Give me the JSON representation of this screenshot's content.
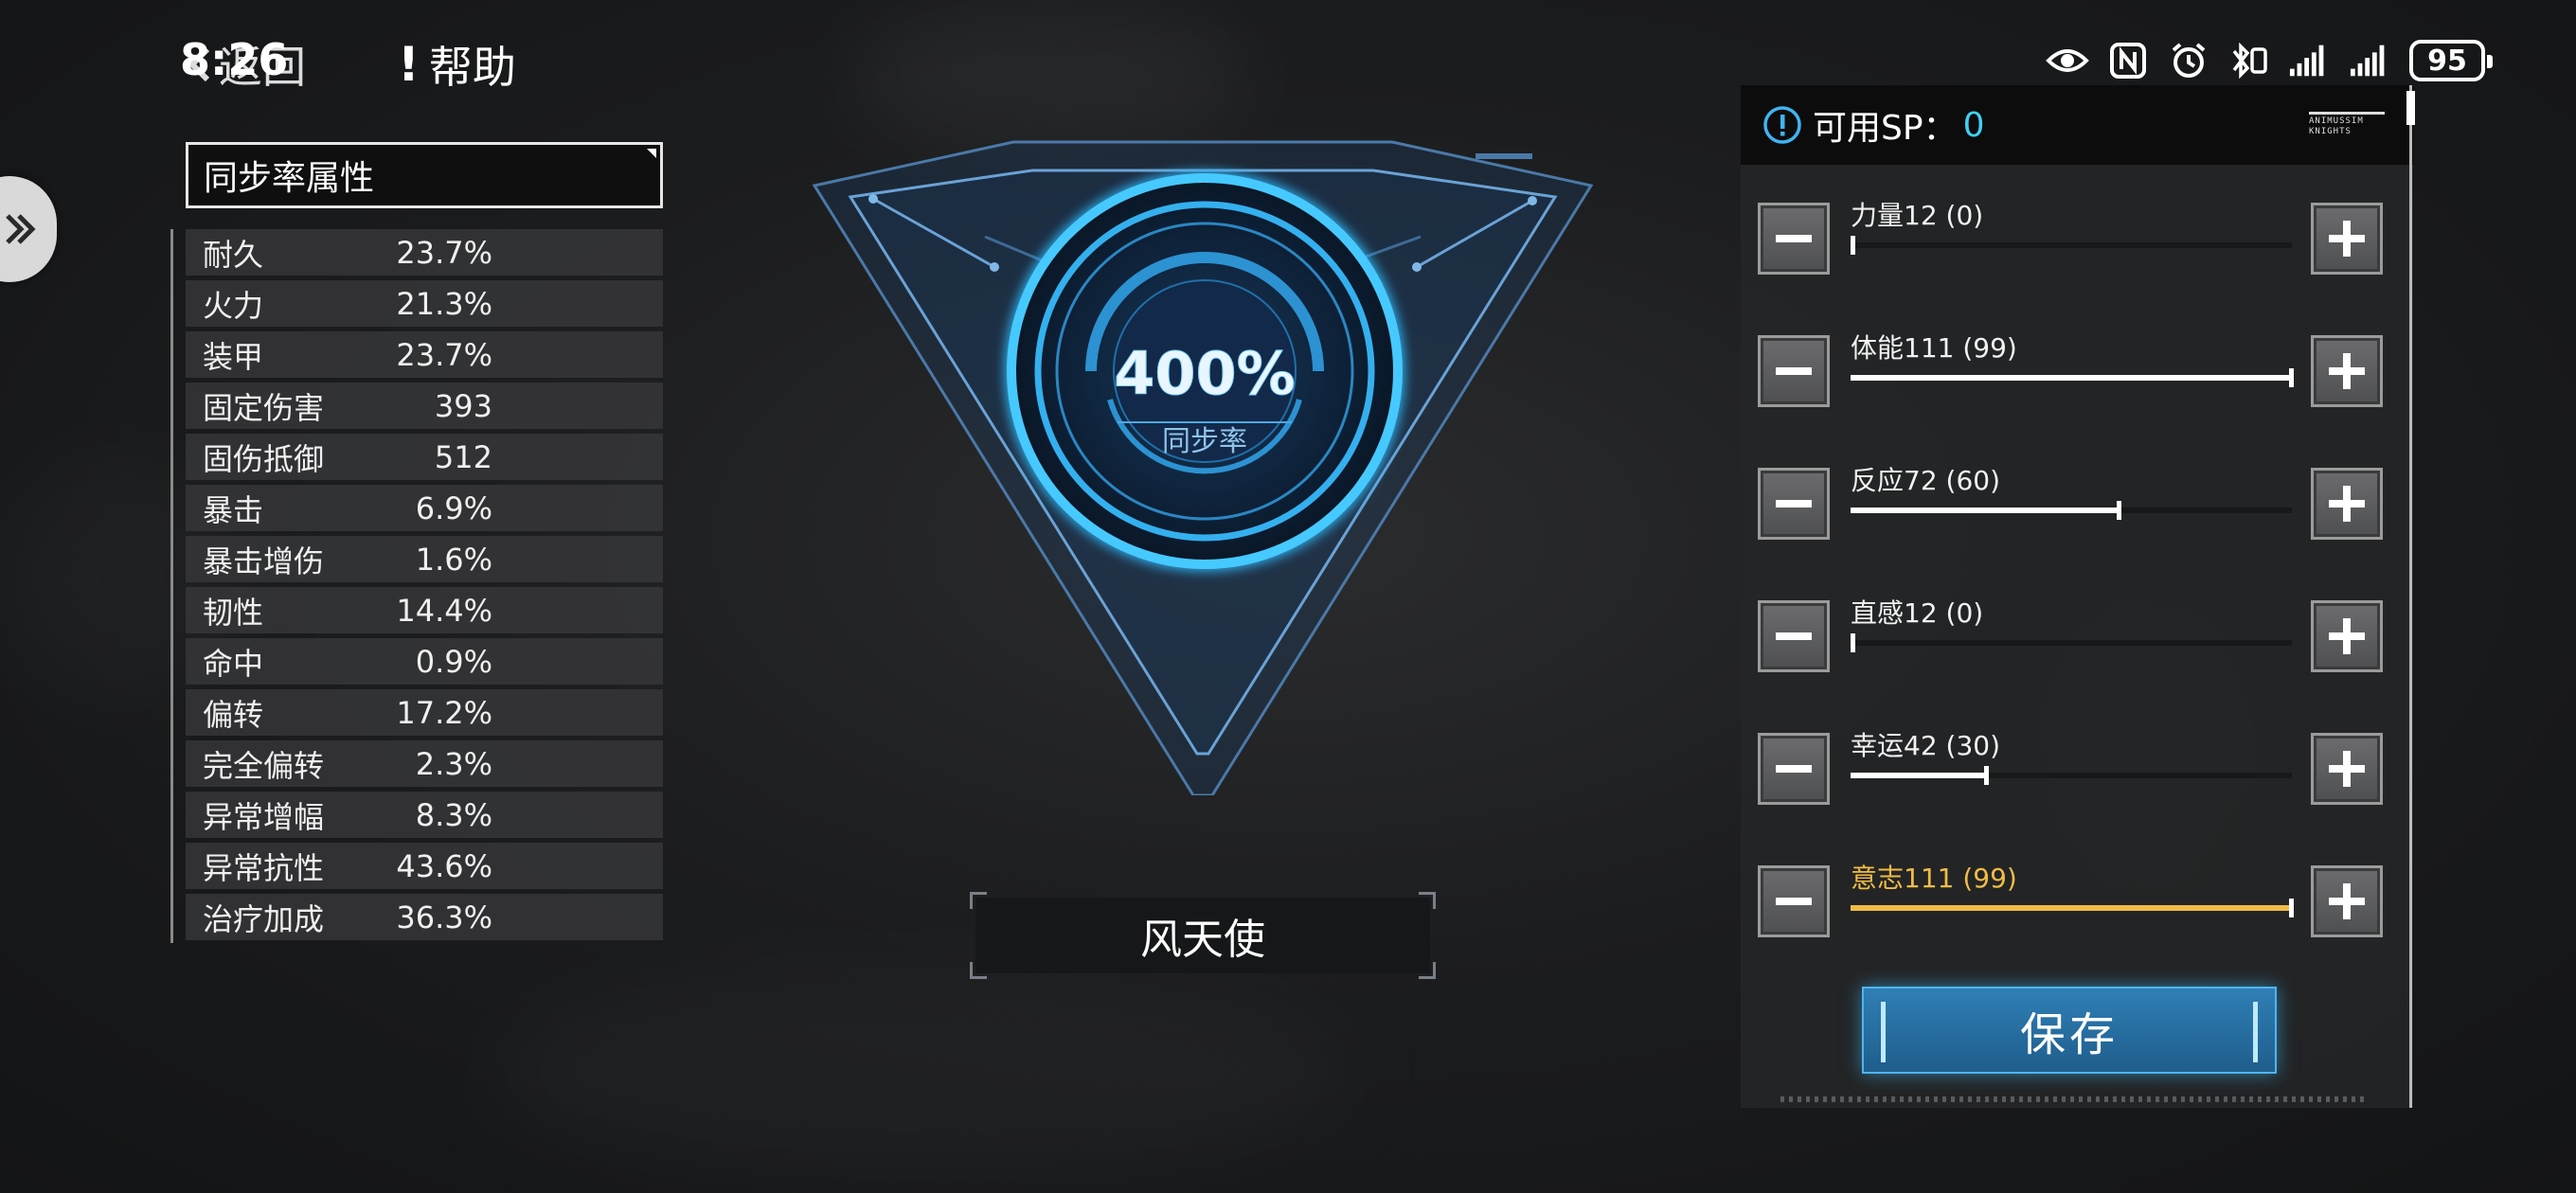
{
  "status_bar": {
    "time": "8:26",
    "battery": "95",
    "icons": [
      "eye-icon",
      "nfc-icon",
      "alarm-icon",
      "bluetooth-icon",
      "vibrate-icon",
      "signal-icon",
      "signal-icon"
    ]
  },
  "nav": {
    "back_label": "返回",
    "help_label": "帮助",
    "help_mark": "!"
  },
  "attributes": {
    "title": "同步率属性",
    "items": [
      {
        "name": "耐久",
        "value": "23.7%"
      },
      {
        "name": "火力",
        "value": "21.3%"
      },
      {
        "name": "装甲",
        "value": "23.7%"
      },
      {
        "name": "固定伤害",
        "value": "393"
      },
      {
        "name": "固伤抵御",
        "value": "512"
      },
      {
        "name": "暴击",
        "value": "6.9%"
      },
      {
        "name": "暴击增伤",
        "value": "1.6%"
      },
      {
        "name": "韧性",
        "value": "14.4%"
      },
      {
        "name": "命中",
        "value": "0.9%"
      },
      {
        "name": "偏转",
        "value": "17.2%"
      },
      {
        "name": "完全偏转",
        "value": "2.3%"
      },
      {
        "name": "异常增幅",
        "value": "8.3%"
      },
      {
        "name": "异常抗性",
        "value": "43.6%"
      },
      {
        "name": "治疗加成",
        "value": "36.3%"
      }
    ]
  },
  "sync": {
    "percent": "400%",
    "label": "同步率"
  },
  "character": {
    "name": "风天使"
  },
  "sp_panel": {
    "label": "可用SP：",
    "value": "0",
    "brand_text": "ANIMUSSIM KNIGHTS",
    "accent_color": "#3fd0f0",
    "highlight_color": "#f0bc46",
    "stats": [
      {
        "label": "力量12 (0)",
        "fill": 0.0,
        "highlight": false
      },
      {
        "label": "体能111 (99)",
        "fill": 1.0,
        "highlight": false
      },
      {
        "label": "反应72 (60)",
        "fill": 0.61,
        "highlight": false
      },
      {
        "label": "直感12 (0)",
        "fill": 0.0,
        "highlight": false
      },
      {
        "label": "幸运42 (30)",
        "fill": 0.31,
        "highlight": false
      },
      {
        "label": "意志111 (99)",
        "fill": 1.0,
        "highlight": true
      }
    ],
    "save_label": "保存"
  }
}
